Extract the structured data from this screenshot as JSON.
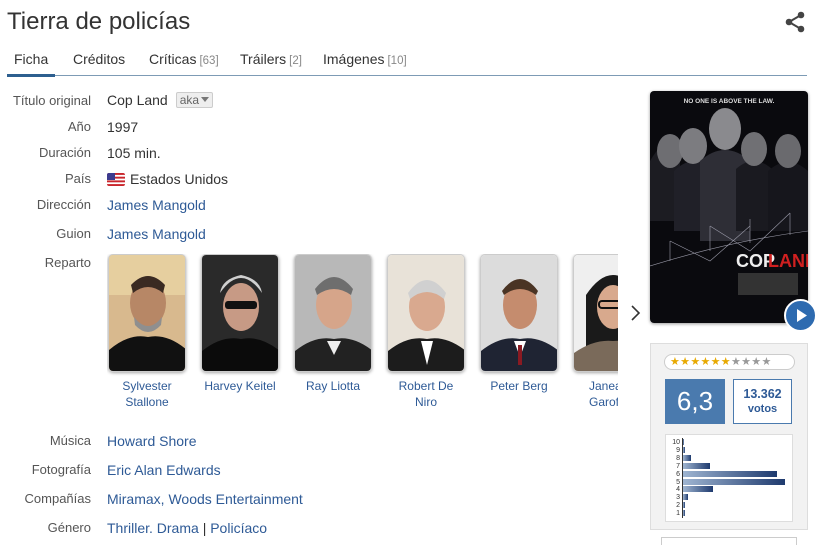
{
  "title": "Tierra de policías",
  "tabs": [
    {
      "label": "Ficha",
      "count": ""
    },
    {
      "label": "Créditos",
      "count": ""
    },
    {
      "label": "Críticas",
      "count": "[63]"
    },
    {
      "label": "Tráilers",
      "count": "[2]"
    },
    {
      "label": "Imágenes",
      "count": "[10]"
    }
  ],
  "details": {
    "original_title_label": "Título original",
    "original_title": "Cop Land",
    "aka_label": "aka",
    "year_label": "Año",
    "year": "1997",
    "duration_label": "Duración",
    "duration": "105 min.",
    "country_label": "País",
    "country": "Estados Unidos",
    "direction_label": "Dirección",
    "director": "James Mangold",
    "script_label": "Guion",
    "writer": "James Mangold",
    "cast_label": "Reparto",
    "music_label": "Música",
    "music": "Howard Shore",
    "photo_label": "Fotografía",
    "photography": "Eric Alan Edwards",
    "companies_label": "Compañías",
    "companies": "Miramax, Woods Entertainment",
    "genre_label": "Género",
    "genre_1": "Thriller. Drama",
    "genre_sep": "|",
    "genre_2": "Policíaco"
  },
  "cast": [
    {
      "name": "Sylvester Stallone"
    },
    {
      "name": "Harvey Keitel"
    },
    {
      "name": "Ray Liotta"
    },
    {
      "name": "Robert De Niro"
    },
    {
      "name": "Peter Berg"
    },
    {
      "name": "Janeane Garofalo"
    }
  ],
  "poster": {
    "tagline": "NO ONE IS ABOVE THE LAW.",
    "title_part1": "COP",
    "title_part2": "LAND"
  },
  "rating": {
    "stars": 6.3,
    "stars_on": "★★★★★★",
    "stars_off": "★★★★",
    "score": "6,3",
    "votes": "13.362",
    "votes_label": "votos",
    "distribution": [
      {
        "label": "10",
        "value": 0.0
      },
      {
        "label": "9",
        "value": 0.02
      },
      {
        "label": "8",
        "value": 0.08
      },
      {
        "label": "7",
        "value": 0.26
      },
      {
        "label": "6",
        "value": 0.92
      },
      {
        "label": "5",
        "value": 1.0
      },
      {
        "label": "4",
        "value": 0.29
      },
      {
        "label": "3",
        "value": 0.05
      },
      {
        "label": "2",
        "value": 0.02
      },
      {
        "label": "1",
        "value": 0.02
      }
    ]
  },
  "colors": {
    "link": "#2e5a96",
    "score_bg": "#4a7aae",
    "tab_underline": "#2d5f8f"
  }
}
